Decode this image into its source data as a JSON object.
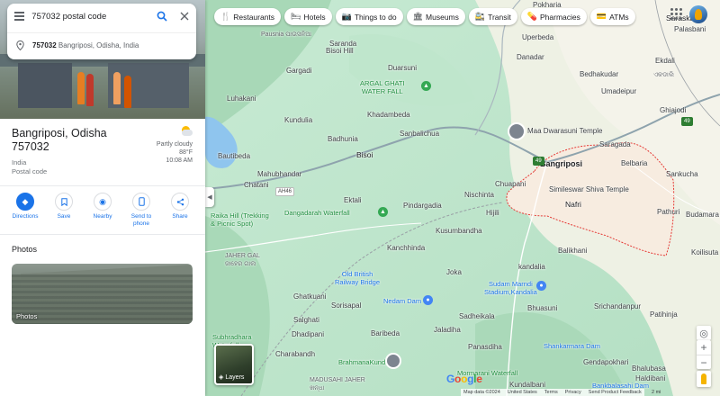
{
  "search": {
    "query": "757032 postal code"
  },
  "suggestion": {
    "code": "757032",
    "rest": " Bangriposi, Odisha, India"
  },
  "place": {
    "title_line1": "Bangriposi, Odisha",
    "title_line2": "757032",
    "country": "India",
    "type": "Postal code"
  },
  "weather": {
    "condition": "Partly cloudy",
    "temp": "88°F",
    "time": "10:08 AM"
  },
  "actions": [
    {
      "label": "Directions",
      "icon": "directions-icon"
    },
    {
      "label": "Save",
      "icon": "bookmark-icon"
    },
    {
      "label": "Nearby",
      "icon": "nearby-icon"
    },
    {
      "label": "Send to phone",
      "icon": "phone-icon"
    },
    {
      "label": "Share",
      "icon": "share-icon"
    }
  ],
  "photos": {
    "section_title": "Photos",
    "card_label": "Photos"
  },
  "chips": [
    {
      "label": "Restaurants",
      "icon": "🍴"
    },
    {
      "label": "Hotels",
      "icon": "🛏"
    },
    {
      "label": "Things to do",
      "icon": "📷"
    },
    {
      "label": "Museums",
      "icon": "🏛"
    },
    {
      "label": "Transit",
      "icon": "🚉"
    },
    {
      "label": "Pharmacies",
      "icon": "💊"
    },
    {
      "label": "ATMs",
      "icon": "💳"
    }
  ],
  "map_labels": {
    "pokharia": "Pokharia",
    "saraskana": "Saraskana",
    "palasbani": "Palasbani",
    "pausnia": "Pausnia ପାଉସନିଆ",
    "saranda": "Saranda",
    "bisoi_hill": "Bisoi Hill",
    "uperbeda": "Uperbeda",
    "danadar": "Danadar",
    "gargadi": "Gargadi",
    "duarsuni": "Duarsuni",
    "bedhakudar": "Bedhakudar",
    "ekdali": "Ekdali",
    "ekdali_odia": "ଏକଡାଲି",
    "argal_ghati": "ARGAL GHATI\nWATER FALL",
    "umadeipur": "Umadeipur",
    "luhakani": "Luhakani",
    "ghiajodi": "Ghiajodi",
    "khadambeda": "Khadambeda",
    "kundulia": "Kundulia",
    "maa_dwarasuni": "Maa Dwarasuni Temple",
    "sanbalichua": "Sanbalichua",
    "badhunia": "Badhunia",
    "saragada": "Saragada",
    "bautibeda": "Bautibeda",
    "bisoi": "Bisoi",
    "bangriposi": "Bangriposi",
    "belbaria": "Belbaria",
    "mahubhandar": "Mahubhandar",
    "sankucha": "Sankucha",
    "chatani": "Chatani",
    "chuapani": "Chuapani",
    "simileswar": "Simileswar Shiva Temple",
    "nischinta": "Nischinta",
    "ektali": "Ektali",
    "raika_hill": "Raika Hill (Trekking\n& Picnic Spot)",
    "hijili": "Hijili",
    "nafri": "Nafri",
    "pathuri": "Pathuri",
    "budamara": "Budamara",
    "pindargadia": "Pindargadia",
    "dangadarah": "Dangadarah Waterfall",
    "kusumbandha": "Kusumbandha",
    "balikhani": "Balikhani",
    "kanchhinda": "Kanchhinda",
    "jaher_gal": "JAHER GAL\nଜାହେର ଗାଲ",
    "koilisuta": "Koilisuta",
    "kandalia": "kandalia",
    "old_british": "Old British\nRailway Bridge",
    "joka": "Joka",
    "sudam_marndi": "Sudam Marndi\nStadium,Kandalia",
    "ghatkuani": "Ghatkuani",
    "sorisapal": "Sorisapal",
    "nedam_dam": "Nedam Dam",
    "srichandanpur": "Srichandanpur",
    "sadheikala": "Sadheikala",
    "bhuasuni": "Bhuasuni",
    "patihinja": "Patihinja",
    "salghati": "Salghati",
    "dhadipani": "Dhadipani",
    "jaladiha": "Jaladiha",
    "baribeda": "Baribeda",
    "subhradhara": "Subhradhara\nWaterfall",
    "panasdiha": "Panasdiha",
    "shankarmara": "Shankarmara Dam",
    "charabandh": "Charabandh",
    "gendapokhari": "Gendapokhari",
    "bhalubasa": "Bhalubasa",
    "brahmanakunda": "BrahmanaKunda",
    "madusahi": "MADUSAHI JAHER\nଖନ୍ଧା",
    "mormarani": "Mormarani Waterfall",
    "kundalbani": "Kundalbani",
    "haldibani": "Haldibani",
    "bankbalasahi": "Bankbalasahi Dam"
  },
  "road_shields": {
    "nh49_a": "49",
    "nh49_b": "49",
    "ah46": "AH46"
  },
  "layers": {
    "label": "Layers"
  },
  "footer": {
    "items": [
      "Map data ©2024",
      "United States",
      "Terms",
      "Privacy",
      "Send Product Feedback"
    ],
    "scale": "2 mi"
  },
  "colors": {
    "accent": "#1a73e8",
    "map_green": "#b7e4c7",
    "boundary": "#e53935"
  }
}
